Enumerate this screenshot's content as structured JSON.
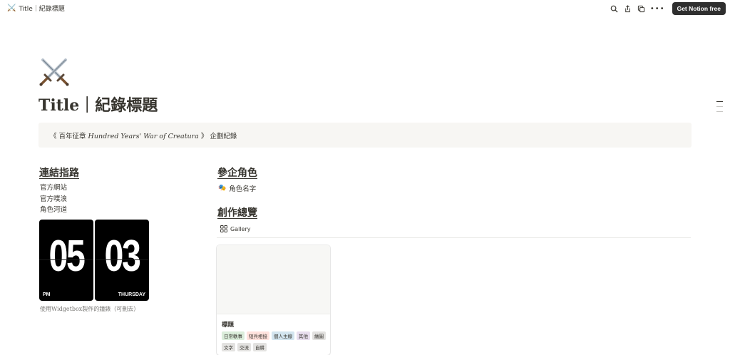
{
  "topbar": {
    "icon": "⚔️",
    "breadcrumb": "Title｜紀錄標題",
    "more": "•••",
    "cta": "Get Notion free"
  },
  "page": {
    "icon": "crossed-swords-icon",
    "title": "Title｜紀錄標題"
  },
  "callout": {
    "prefix": "《 百年征章 ",
    "italic": "Hundred Years' War of Creatura",
    "suffix": " 》 企劃紀錄"
  },
  "links": {
    "heading": "連結指路",
    "items": [
      "官方網站",
      "官方噗浪",
      "角色河道"
    ]
  },
  "clock": {
    "hour": "05",
    "minute": "03",
    "period": "PM",
    "weekday": "THURSDAY",
    "caption": "使用Widgetbox製作的鐘錶（可刪去）"
  },
  "characters": {
    "heading": "參企角色",
    "item_icon": "🎭",
    "item": "角色名字"
  },
  "works": {
    "heading": "創作總覽",
    "view_label": "Gallery",
    "card": {
      "title": "標題",
      "tags": [
        {
          "label": "日常軼事",
          "bg": "#dbeddb"
        },
        {
          "label": "短兵相接",
          "bg": "#ffe2dd"
        },
        {
          "label": "個人主線",
          "bg": "#d3e5ef"
        },
        {
          "label": "其他",
          "bg": "#e8deee"
        },
        {
          "label": "繪圖",
          "bg": "#e3e2e0"
        },
        {
          "label": "文字",
          "bg": "#e3e2e0"
        },
        {
          "label": "交流",
          "bg": "#e3e2e0"
        },
        {
          "label": "自耕",
          "bg": "#e3e2e0"
        }
      ]
    }
  },
  "colors": {
    "text": "#37352f",
    "muted": "#787774",
    "callout_bg": "#f7f6f3",
    "button_bg": "#2f2f2f"
  }
}
